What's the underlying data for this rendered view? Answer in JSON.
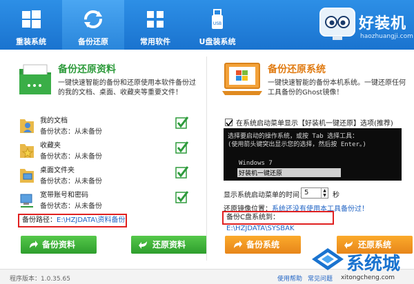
{
  "nav": {
    "tabs": [
      {
        "label": "重装系统",
        "icon": "windows-icon"
      },
      {
        "label": "备份还原",
        "icon": "refresh-icon"
      },
      {
        "label": "常用软件",
        "icon": "apps-grid-icon"
      },
      {
        "label": "U盘装系统",
        "icon": "usb-icon"
      }
    ],
    "active_tab": 1,
    "brand_name": "好装机",
    "brand_url": "haozhuangji.com"
  },
  "left_panel": {
    "title": "备份还原资料",
    "desc": "一键快速智能的备份和还原使用本软件备份过的我的文档、桌面、收藏夹等重要文件！",
    "items": [
      {
        "name": "我的文档",
        "status": "备份状态：从未备份",
        "checked": true
      },
      {
        "name": "收藏夹",
        "status": "备份状态：从未备份",
        "checked": true
      },
      {
        "name": "桌面文件夹",
        "status": "备份状态：从未备份",
        "checked": true
      },
      {
        "name": "宽带账号和密码",
        "status": "备份状态：从未备份",
        "checked": true
      }
    ],
    "path_label": "备份路径：",
    "path_value": "E:\\HZJDATA\\资料备份",
    "backup_btn": "备份资料",
    "restore_btn": "还原资料"
  },
  "right_panel": {
    "title": "备份还原系统",
    "desc": "一键快速智能的备份本机系统。一键还原任何工具备份的Ghost镜像！",
    "boot_menu_check": "在系统启动菜单显示【好装机一键还原】选项(推荐)",
    "console": {
      "line1": "选择要启动的操作系统，或按 Tab 选择工具：",
      "line2": "(使用箭头键突出显示您的选择，然后按 Enter。)",
      "option1": "Windows 7",
      "option2": "好装机一键还原"
    },
    "timeout_label": "显示系统启动菜单的时间：",
    "timeout_value": "5",
    "timeout_unit": "秒",
    "mirror_label": "还原镜像位置：",
    "mirror_value": "系统还没有使用本工具备份过！",
    "c_backup_label": "备份C盘系统到：",
    "c_backup_value": "E:\\HZJDATA\\SYSBAK",
    "backup_btn": "备份系统",
    "restore_btn": "还原系统"
  },
  "footer": {
    "version": "程序版本：1.0.35.65",
    "help": "使用帮助",
    "faq": "常见问题"
  },
  "watermark": {
    "text": "系统城",
    "url": "xitongcheng.com"
  },
  "colors": {
    "topbar": "#1a73cf",
    "left_accent": "#2e9b3c",
    "right_accent": "#e07b12",
    "highlight_box": "#e02020",
    "link": "#1f63c4"
  }
}
